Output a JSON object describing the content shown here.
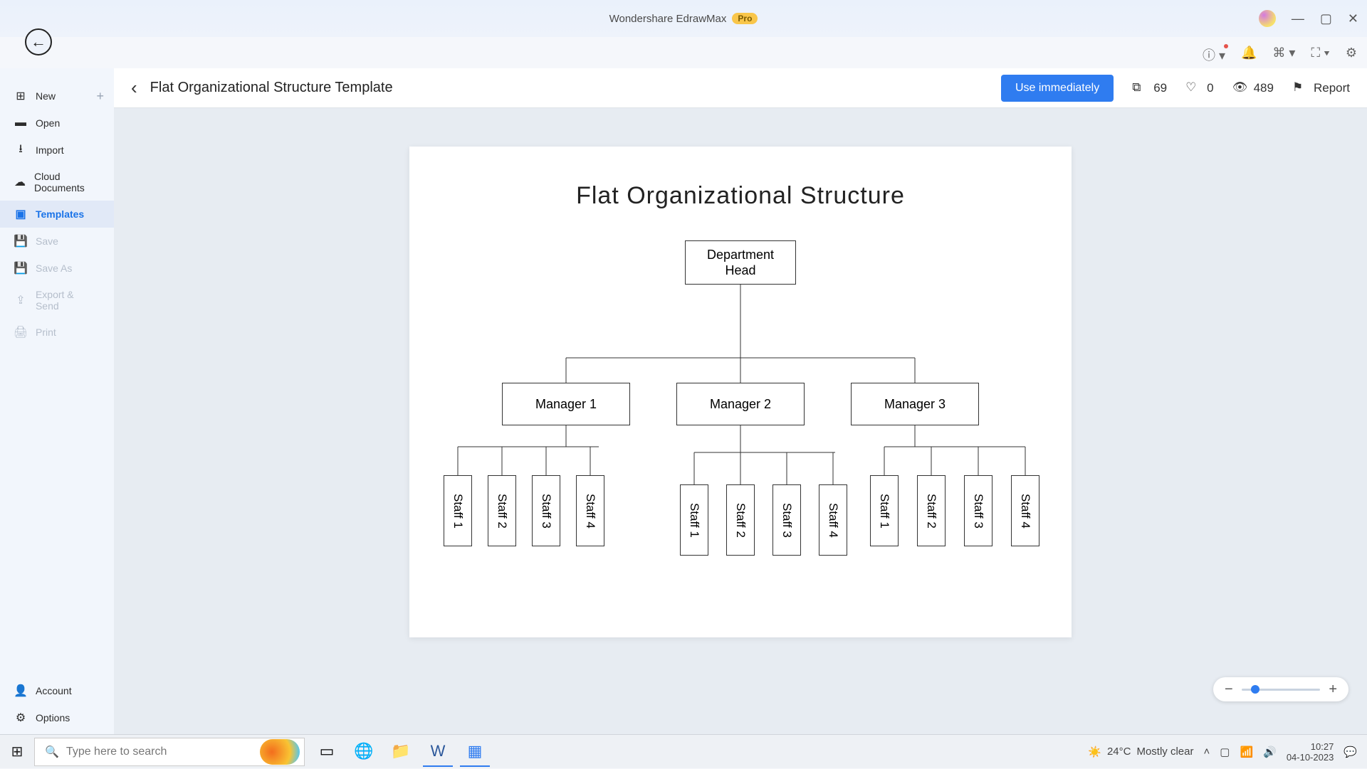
{
  "app": {
    "title": "Wondershare EdrawMax",
    "badge": "Pro"
  },
  "sidebar": {
    "items": [
      {
        "label": "New"
      },
      {
        "label": "Open"
      },
      {
        "label": "Import"
      },
      {
        "label": "Cloud Documents"
      },
      {
        "label": "Templates"
      },
      {
        "label": "Save"
      },
      {
        "label": "Save As"
      },
      {
        "label": "Export & Send"
      },
      {
        "label": "Print"
      }
    ],
    "bottom": [
      {
        "label": "Account"
      },
      {
        "label": "Options"
      }
    ]
  },
  "header": {
    "template_name": "Flat Organizational Structure Template",
    "primary_button": "Use immediately",
    "copies": "69",
    "likes": "0",
    "views": "489",
    "report": "Report"
  },
  "chart": {
    "title": "Flat Organizational Structure",
    "head": "Department\nHead",
    "managers": [
      "Manager 1",
      "Manager 2",
      "Manager 3"
    ],
    "staff_set1": [
      "Staff 1",
      "Staff 2",
      "Staff 3",
      "Staff 4"
    ],
    "staff_set2": [
      "Staff 1",
      "Staff 2",
      "Staff 3",
      "Staff 4"
    ],
    "staff_set3": [
      "Staff 1",
      "Staff 2",
      "Staff 3",
      "Staff 4"
    ]
  },
  "taskbar": {
    "search_placeholder": "Type here to search",
    "weather_temp": "24°C",
    "weather_desc": "Mostly clear",
    "time": "10:27",
    "date": "04-10-2023"
  }
}
